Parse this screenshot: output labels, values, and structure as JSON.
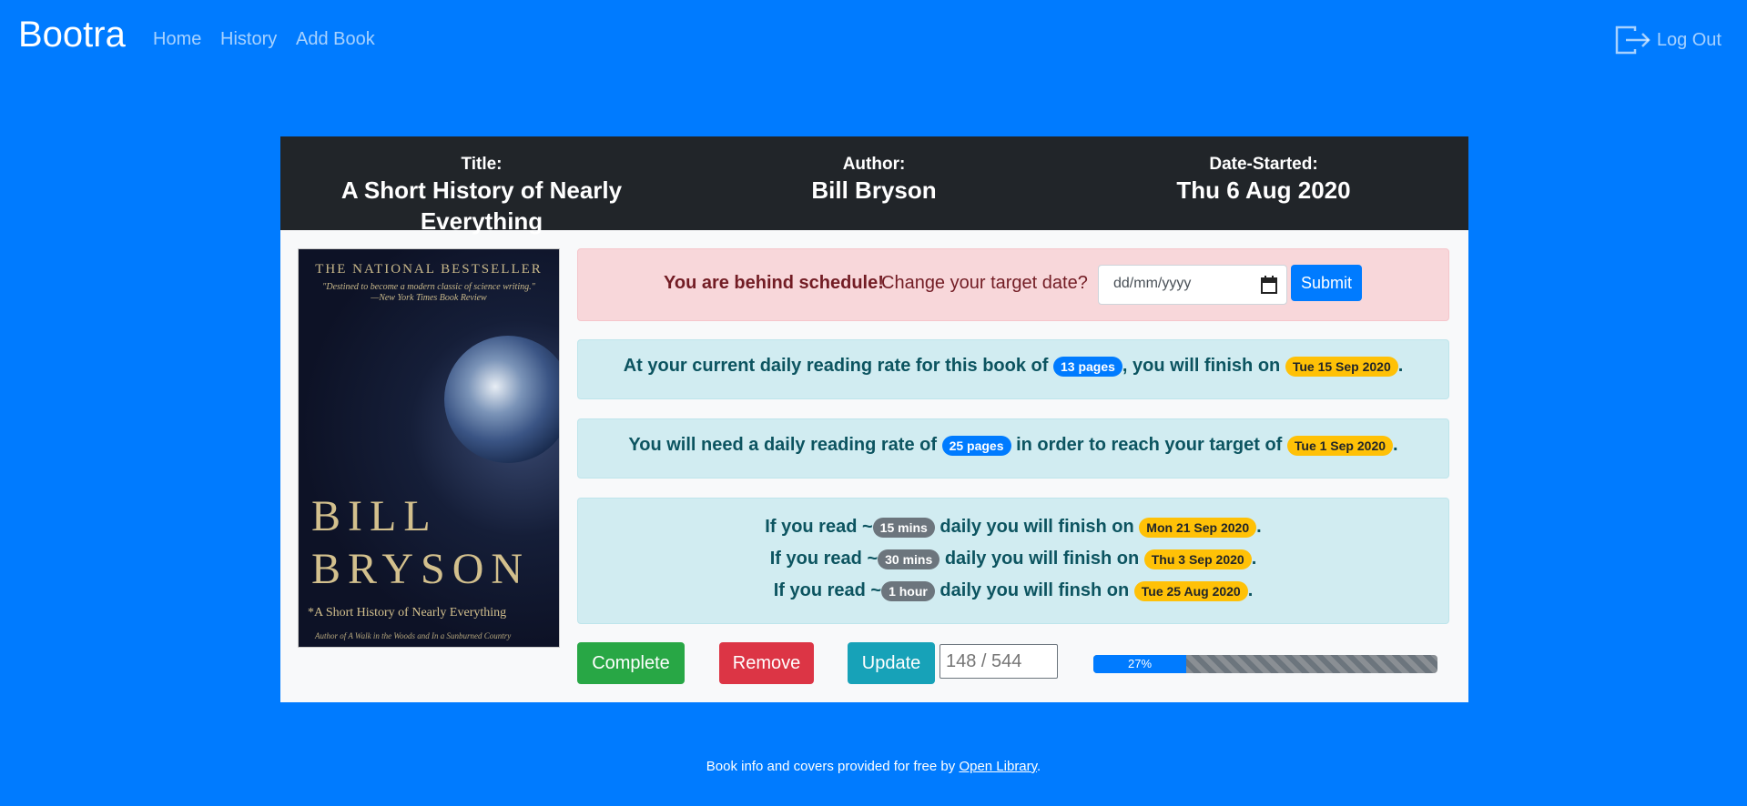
{
  "nav": {
    "brand": "Bootra",
    "links": [
      "Home",
      "History",
      "Add Book"
    ],
    "logout": "Log Out"
  },
  "book": {
    "title_label": "Title:",
    "title": "A Short History of Nearly Everything",
    "author_label": "Author:",
    "author": "Bill Bryson",
    "date_label": "Date-Started:",
    "date_started": "Thu 6 Aug 2020",
    "cover": {
      "top": "THE NATIONAL BESTSELLER",
      "quote": "\"Destined to become a modern classic of science writing.\"",
      "quote_source": "—New York Times Book Review",
      "author_line1": "BILL",
      "author_line2": "BRYSON",
      "subtitle": "*A Short History of Nearly Everything",
      "foot": "Author of A Walk in the Woods and In a Sunburned Country"
    }
  },
  "schedule": {
    "behind": "You are behind schedule!",
    "prompt": "Change your target date?",
    "date_placeholder": "dd/mm/yyyy",
    "submit": "Submit"
  },
  "current_rate": {
    "prefix": "At your current daily reading rate for this book of",
    "pages": "13 pages",
    "middle": ", you will finish on",
    "date": "Tue 15 Sep 2020",
    "suffix": "."
  },
  "target_rate": {
    "prefix": "You will need a daily reading rate of",
    "pages": "25 pages",
    "middle": "in order to reach your target of",
    "date": "Tue 1 Sep 2020",
    "suffix": "."
  },
  "time_estimates": [
    {
      "prefix": "If you read ~",
      "time": "15 mins",
      "middle": "daily you will finish on",
      "date": "Mon 21 Sep 2020",
      "suffix": "."
    },
    {
      "prefix": "If you read ~",
      "time": "30 mins",
      "middle": "daily you will finish on",
      "date": "Thu 3 Sep 2020",
      "suffix": "."
    },
    {
      "prefix": "If you read ~",
      "time": "1 hour",
      "middle": "daily you will finsh on",
      "date": "Tue 25 Aug 2020",
      "suffix": "."
    }
  ],
  "actions": {
    "complete": "Complete",
    "remove": "Remove",
    "update": "Update",
    "page_placeholder": "148 / 544"
  },
  "progress": {
    "percent": 27,
    "label": "27%"
  },
  "footer": {
    "text": "Book info and covers provided for free by",
    "link": "Open Library",
    "suffix": "."
  },
  "colors": {
    "background": "#007bff",
    "header": "#212529",
    "danger_bg": "#f8d7da",
    "info_bg": "#d1ecf1"
  }
}
